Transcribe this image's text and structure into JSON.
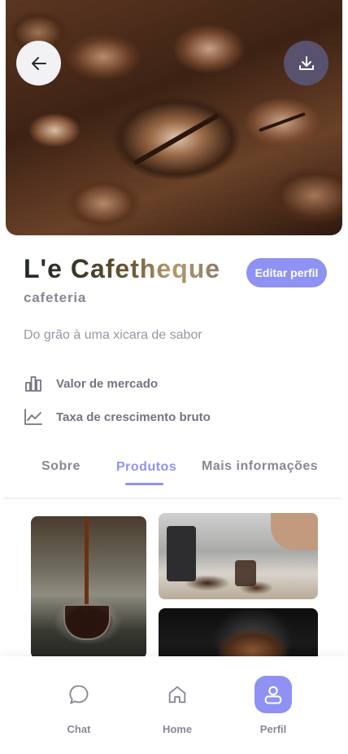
{
  "profile": {
    "name": "L'e Cafetheque",
    "category": "cafeteria",
    "tagline": "Do grão à uma xicara de sabor",
    "edit_label": "Editar perfil"
  },
  "stats": [
    {
      "icon": "bar-chart-icon",
      "label": "Valor de mercado"
    },
    {
      "icon": "line-chart-icon",
      "label": "Taxa de crescimento bruto"
    }
  ],
  "tabs": [
    {
      "label": "Sobre",
      "active": false
    },
    {
      "label": "Produtos",
      "active": true
    },
    {
      "label": "Mais informações",
      "active": false
    }
  ],
  "bottom_nav": [
    {
      "label": "Chat",
      "icon": "chat-bubble-icon",
      "active": false
    },
    {
      "label": "Home",
      "icon": "home-icon",
      "active": false
    },
    {
      "label": "Perfil",
      "icon": "user-icon",
      "active": true
    }
  ],
  "colors": {
    "accent": "#8f92f2",
    "text_muted": "#8b8694",
    "download_button": "#58526e"
  }
}
